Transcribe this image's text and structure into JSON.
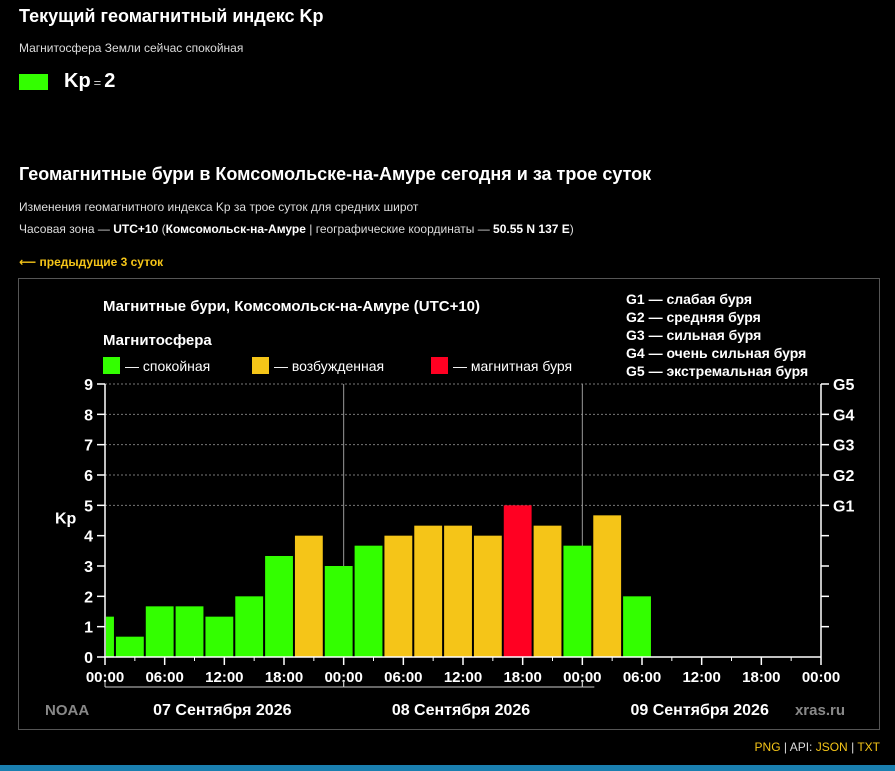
{
  "header": {
    "title": "Текущий геомагнитный индекс Kp",
    "subtitle": "Магнитосфера Земли сейчас спокойная",
    "kp_label": "Kp",
    "kp_eq": "=",
    "kp_value": "2",
    "kp_color": "#33ff00"
  },
  "section": {
    "title": "Геомагнитные бури в Комсомольске-на-Амуре сегодня и за трое суток",
    "description": "Изменения геомагнитного индекса Kp за трое суток для средних широт",
    "tz_prefix": "Часовая зона — ",
    "tz": "UTC+10",
    "tz_city_open": " (",
    "tz_city": "Комсомольск-на-Амуре",
    "tz_mid": " | географические координаты — ",
    "coords": "50.55 N 137 E",
    "tz_close": ")",
    "prev_link": "⟵ предыдущие 3 суток"
  },
  "chart_data": {
    "type": "bar",
    "title": "Магнитные бури, Комсомольск-на-Амуре (UTC+10)",
    "legend_title": "Магнитосфера",
    "legend": [
      {
        "label": "— спокойная",
        "color": "#33ff00"
      },
      {
        "label": "— возбужденная",
        "color": "#f5c518"
      },
      {
        "label": "— магнитная буря",
        "color": "#ff0022"
      }
    ],
    "g_legend": [
      "G1 — слабая буря",
      "G2 — средняя буря",
      "G3 — сильная буря",
      "G4 — очень сильная буря",
      "G5 — экстремальная буря"
    ],
    "ylabel": "Kp",
    "ylim": [
      0,
      9
    ],
    "yticks": [
      "0",
      "1",
      "2",
      "3",
      "4",
      "5",
      "6",
      "7",
      "8",
      "9"
    ],
    "right_ticks": [
      {
        "label": "G1",
        "value": 5
      },
      {
        "label": "G2",
        "value": 6
      },
      {
        "label": "G3",
        "value": 7
      },
      {
        "label": "G4",
        "value": 8
      },
      {
        "label": "G5",
        "value": 9
      }
    ],
    "xlim_hours": [
      0,
      72
    ],
    "xticks": [
      "00:00",
      "06:00",
      "12:00",
      "18:00",
      "00:00",
      "06:00",
      "12:00",
      "18:00",
      "00:00",
      "06:00",
      "12:00",
      "18:00",
      "00:00"
    ],
    "days": [
      "07 Сентября 2026",
      "08 Сентября 2026",
      "09 Сентября 2026"
    ],
    "bars": [
      {
        "start": 0,
        "end": 1,
        "value": 1.33,
        "level": "quiet"
      },
      {
        "start": 1,
        "end": 4,
        "value": 0.67,
        "level": "quiet"
      },
      {
        "start": 4,
        "end": 7,
        "value": 1.67,
        "level": "quiet"
      },
      {
        "start": 7,
        "end": 10,
        "value": 1.67,
        "level": "quiet"
      },
      {
        "start": 10,
        "end": 13,
        "value": 1.33,
        "level": "quiet"
      },
      {
        "start": 13,
        "end": 16,
        "value": 2.0,
        "level": "quiet"
      },
      {
        "start": 16,
        "end": 19,
        "value": 3.33,
        "level": "quiet"
      },
      {
        "start": 19,
        "end": 22,
        "value": 4.0,
        "level": "active"
      },
      {
        "start": 22,
        "end": 25,
        "value": 3.0,
        "level": "quiet"
      },
      {
        "start": 25,
        "end": 28,
        "value": 3.67,
        "level": "quiet"
      },
      {
        "start": 28,
        "end": 31,
        "value": 4.0,
        "level": "active"
      },
      {
        "start": 31,
        "end": 34,
        "value": 4.33,
        "level": "active"
      },
      {
        "start": 34,
        "end": 37,
        "value": 4.33,
        "level": "active"
      },
      {
        "start": 37,
        "end": 40,
        "value": 4.0,
        "level": "active"
      },
      {
        "start": 40,
        "end": 43,
        "value": 5.0,
        "level": "storm"
      },
      {
        "start": 43,
        "end": 46,
        "value": 4.33,
        "level": "active"
      },
      {
        "start": 46,
        "end": 49,
        "value": 3.67,
        "level": "quiet"
      },
      {
        "start": 49,
        "end": 52,
        "value": 4.67,
        "level": "active"
      },
      {
        "start": 52,
        "end": 55,
        "value": 2.0,
        "level": "quiet"
      }
    ],
    "level_colors": {
      "quiet": "#33ff00",
      "active": "#f5c518",
      "storm": "#ff0022"
    },
    "source_left": "NOAA",
    "source_right": "xras.ru",
    "grid": true
  },
  "footer": {
    "png": "PNG",
    "sep": "|",
    "api": "API:",
    "json": "JSON",
    "txt": "TXT"
  }
}
